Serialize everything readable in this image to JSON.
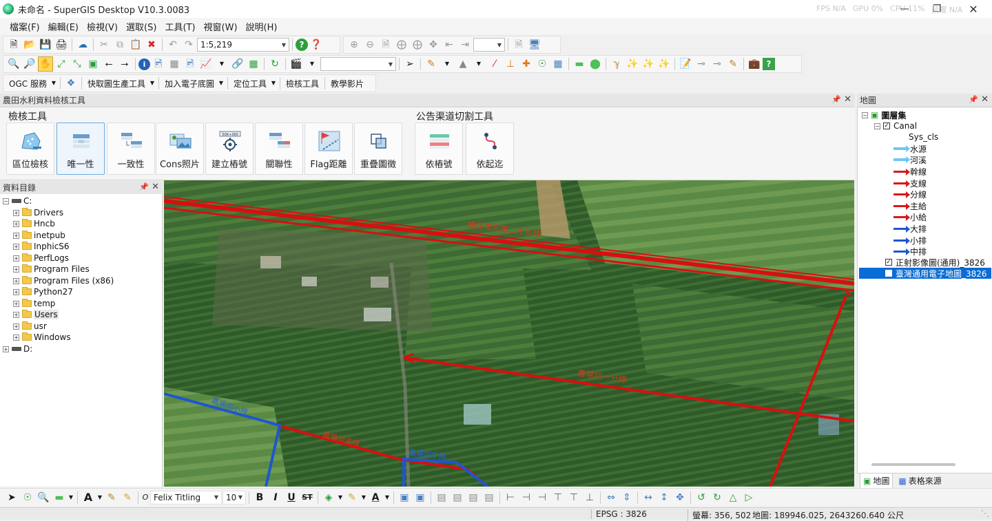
{
  "app": {
    "title": "未命名 - SuperGIS Desktop V10.3.0083",
    "overlay": [
      "FPS N/A",
      "GPU 0%",
      "CPU 11%",
      "延遲 N/A"
    ]
  },
  "menu": [
    "檔案(F)",
    "編輯(E)",
    "檢視(V)",
    "選取(S)",
    "工具(T)",
    "視窗(W)",
    "說明(H)"
  ],
  "toolbar": {
    "scale_value": "1:5,219",
    "row3": [
      "OGC 服務",
      "快取圖生產工具",
      "加入電子底圖",
      "定位工具",
      "檢核工具",
      "教學影片"
    ]
  },
  "inspection_panel": {
    "title": "農田水利資料檢核工具",
    "group1_label": "檢核工具",
    "group2_label": "公告渠道切割工具",
    "buttons1": [
      "區位檢核",
      "唯一性",
      "一致性",
      "Cons照片",
      "建立樁號",
      "關聯性",
      "Flag距離",
      "重疊圖徵"
    ],
    "buttons2": [
      "依樁號",
      "依起迄"
    ],
    "active_button": "唯一性"
  },
  "catalog": {
    "title": "資料目錄",
    "root": "C:",
    "folders": [
      "Drivers",
      "Hncb",
      "inetpub",
      "InphicS6",
      "PerfLogs",
      "Program Files",
      "Program Files (x86)",
      "Python27",
      "temp",
      "Users",
      "usr",
      "Windows"
    ],
    "drive2": "D:"
  },
  "map_labels": {
    "label1": "鯉仔潭圳第二十支線",
    "label2": "農場圳一分線",
    "label3": "農場圳支線",
    "label4": "農場圳中排",
    "label5": "農場圳小排"
  },
  "legend": {
    "title": "地圖",
    "root": "圖層集",
    "layer": "Canal",
    "field": "Sys_cls",
    "classes": [
      {
        "label": "水源",
        "color": "#6ec6f5"
      },
      {
        "label": "河溪",
        "color": "#6ec6f5"
      },
      {
        "label": "幹線",
        "color": "#d81818"
      },
      {
        "label": "支線",
        "color": "#d81818"
      },
      {
        "label": "分線",
        "color": "#d81818"
      },
      {
        "label": "主給",
        "color": "#d81818"
      },
      {
        "label": "小給",
        "color": "#d81818"
      },
      {
        "label": "大排",
        "color": "#1e56d0"
      },
      {
        "label": "小排",
        "color": "#1e56d0"
      },
      {
        "label": "中排",
        "color": "#1e56d0"
      }
    ],
    "layer2": "正射影像圖(通用)_3826",
    "layer3": "臺灣通用電子地圖_3826",
    "tab1": "地圖",
    "tab2": "表格來源"
  },
  "drawing": {
    "font": "Felix Titling",
    "size": "10"
  },
  "status": {
    "epsg": "EPSG : 3826",
    "screen": "螢幕: 356, 502",
    "map": "地圖: 189946.025, 2643260.640 公尺"
  }
}
